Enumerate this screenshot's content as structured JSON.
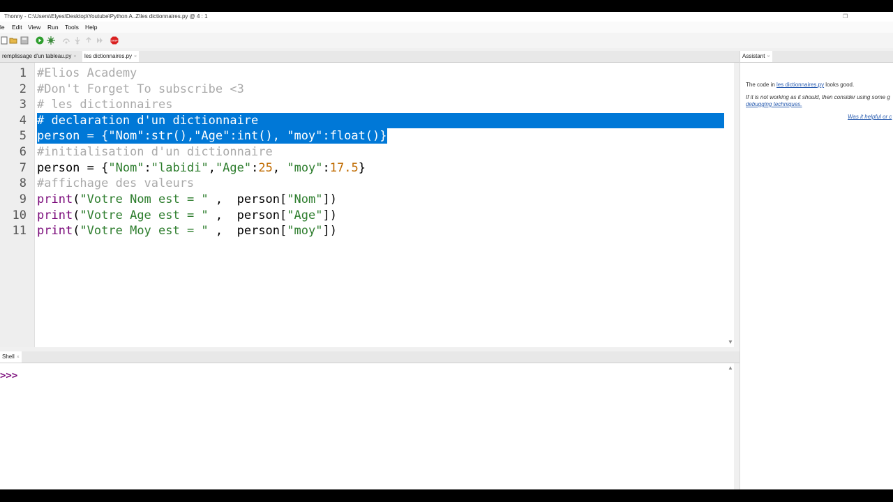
{
  "window": {
    "title": "Thonny  -  C:\\Users\\Elyes\\Desktop\\Youtube\\Python A..Z\\les dictionnaires.py  @  4 : 1"
  },
  "menu": [
    "le",
    "Edit",
    "View",
    "Run",
    "Tools",
    "Help"
  ],
  "toolbar": {
    "icons": [
      "new-file-icon",
      "open-folder-icon",
      "save-icon",
      "run-icon",
      "debug-icon",
      "step-over-icon",
      "step-into-icon",
      "step-out-icon",
      "resume-icon",
      "stop-icon"
    ],
    "stop_label": "STOP",
    "colors": {
      "run": "#2e9e2e",
      "stop": "#d92020"
    }
  },
  "tabs": [
    {
      "label": "remplissage d'un tableau.py",
      "active": false
    },
    {
      "label": "les dictionnaires.py",
      "active": true
    }
  ],
  "close_glyph": "×",
  "editor": {
    "selection_color": "#0078d7",
    "lines": [
      {
        "num": "1",
        "text": "#Elios Academy"
      },
      {
        "num": "2",
        "text": "#Don't Forget To subscribe <3"
      },
      {
        "num": "3",
        "text": "# les dictionnaires"
      },
      {
        "num": "4",
        "text": "# declaration d'un dictionnaire"
      },
      {
        "num": "5",
        "text": "person = {\"Nom\":str(),\"Age\":int(), \"moy\":float()}"
      },
      {
        "num": "6",
        "text": "#initialisation d'un dictionnaire"
      },
      {
        "num": "7",
        "segments": [
          {
            "t": "person = {",
            "c": ""
          },
          {
            "t": "\"Nom\"",
            "c": "s"
          },
          {
            "t": ":",
            "c": ""
          },
          {
            "t": "\"labidi\"",
            "c": "s"
          },
          {
            "t": ",",
            "c": ""
          },
          {
            "t": "\"Age\"",
            "c": "s"
          },
          {
            "t": ":",
            "c": ""
          },
          {
            "t": "25",
            "c": "n"
          },
          {
            "t": ", ",
            "c": ""
          },
          {
            "t": "\"moy\"",
            "c": "s"
          },
          {
            "t": ":",
            "c": ""
          },
          {
            "t": "17.5",
            "c": "n"
          },
          {
            "t": "}",
            "c": ""
          }
        ]
      },
      {
        "num": "8",
        "text": "#affichage des valeurs"
      },
      {
        "num": "9",
        "segments": [
          {
            "t": "print",
            "c": "k"
          },
          {
            "t": "(",
            "c": ""
          },
          {
            "t": "\"Votre Nom est = \"",
            "c": "s"
          },
          {
            "t": " ,  person[",
            "c": ""
          },
          {
            "t": "\"Nom\"",
            "c": "s"
          },
          {
            "t": "])",
            "c": ""
          }
        ]
      },
      {
        "num": "10",
        "segments": [
          {
            "t": "print",
            "c": "k"
          },
          {
            "t": "(",
            "c": ""
          },
          {
            "t": "\"Votre Age est = \"",
            "c": "s"
          },
          {
            "t": " ,  person[",
            "c": ""
          },
          {
            "t": "\"Age\"",
            "c": "s"
          },
          {
            "t": "])",
            "c": ""
          }
        ]
      },
      {
        "num": "11",
        "segments": [
          {
            "t": "print",
            "c": "k"
          },
          {
            "t": "(",
            "c": ""
          },
          {
            "t": "\"Votre Moy est = \"",
            "c": "s"
          },
          {
            "t": " ,  person[",
            "c": ""
          },
          {
            "t": "\"moy\"",
            "c": "s"
          },
          {
            "t": "])",
            "c": ""
          }
        ]
      }
    ]
  },
  "assistant": {
    "tab": "Assistant",
    "line1_pre": "The code in ",
    "line1_link": "les dictionnaires.py",
    "line1_post": " looks good.",
    "line2": "If it is not working as it should, then consider using some g",
    "line3": "debugging techniques.",
    "feedback": "Was it helpful or c"
  },
  "shell": {
    "tab": "Shell",
    "prompt": ">>>"
  }
}
